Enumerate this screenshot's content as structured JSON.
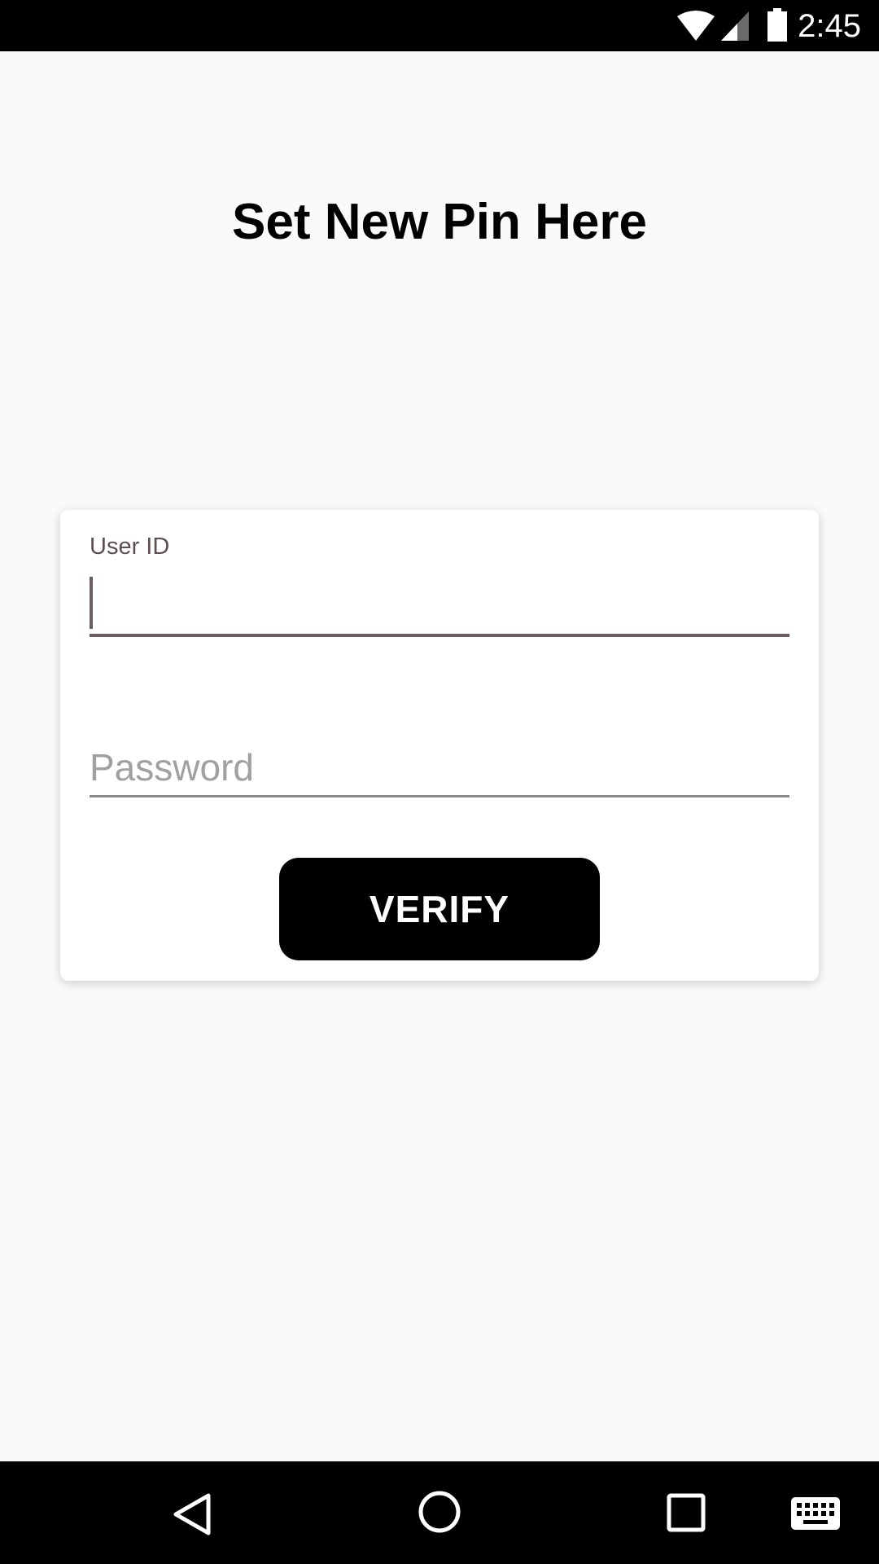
{
  "status_bar": {
    "time": "2:45",
    "icons": [
      "wifi-icon",
      "signal-icon",
      "battery-icon"
    ]
  },
  "page": {
    "title": "Set New Pin Here"
  },
  "form": {
    "user_id_label": "User ID",
    "user_id_value": "",
    "password_placeholder": "Password",
    "password_value": "",
    "verify_label": "VERIFY"
  },
  "nav_bar": {
    "icons": [
      "back-icon",
      "home-icon",
      "recents-icon",
      "keyboard-icon"
    ]
  },
  "colors": {
    "status_bar_bg": "#000000",
    "background": "#fafafa",
    "card_bg": "#ffffff",
    "button_bg": "#000000",
    "button_text": "#ffffff",
    "focused_underline": "#6b5d5d",
    "placeholder": "#a0a0a0"
  }
}
